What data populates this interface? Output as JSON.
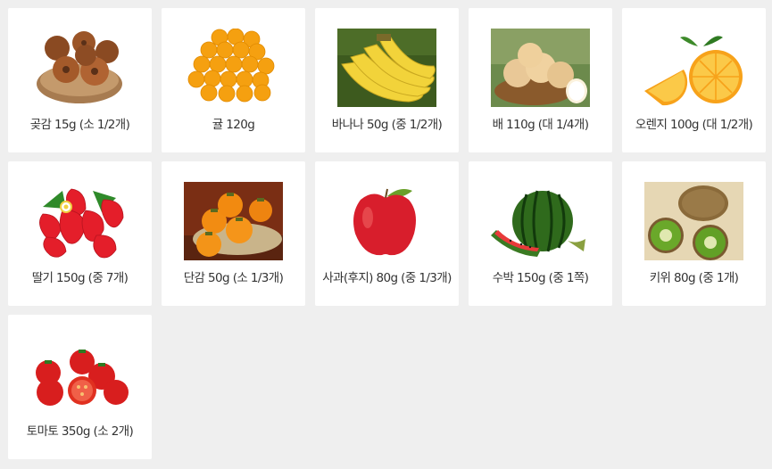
{
  "items": [
    {
      "label": "곶감 15g (소 1/2개)",
      "image": "dried-persimmon"
    },
    {
      "label": "귤 120g",
      "image": "tangerine"
    },
    {
      "label": "바나나 50g (중 1/2개)",
      "image": "banana"
    },
    {
      "label": "배 110g (대 1/4개)",
      "image": "pear"
    },
    {
      "label": "오렌지 100g (대 1/2개)",
      "image": "orange"
    },
    {
      "label": "딸기 150g (중 7개)",
      "image": "strawberry"
    },
    {
      "label": "단감 50g (소 1/3개)",
      "image": "sweet-persimmon"
    },
    {
      "label": "사과(후지) 80g (중 1/3개)",
      "image": "apple"
    },
    {
      "label": "수박 150g (중 1쪽)",
      "image": "watermelon"
    },
    {
      "label": "키위 80g (중 1개)",
      "image": "kiwi"
    },
    {
      "label": "토마토 350g (소 2개)",
      "image": "tomato"
    }
  ]
}
